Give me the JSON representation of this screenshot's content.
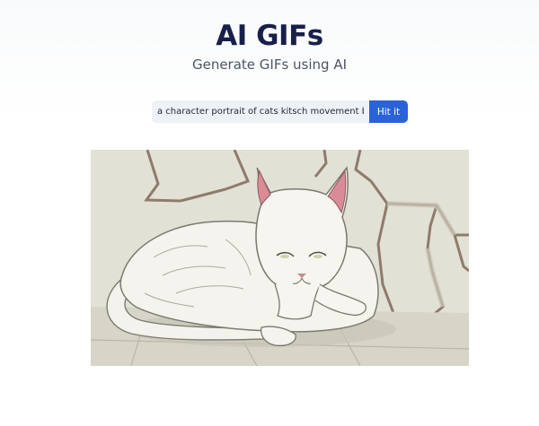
{
  "header": {
    "title": "AI GIFs",
    "subtitle": "Generate GIFs using AI"
  },
  "prompt_form": {
    "input_value": "a character portrait of cats kitsch movement by F",
    "submit_label": "Hit it"
  },
  "result": {
    "alt": "a character portrait of cats kitsch movement by F"
  },
  "colors": {
    "title": "#18204a",
    "button": "#2a63d8",
    "input_bg": "#eef1f6"
  }
}
